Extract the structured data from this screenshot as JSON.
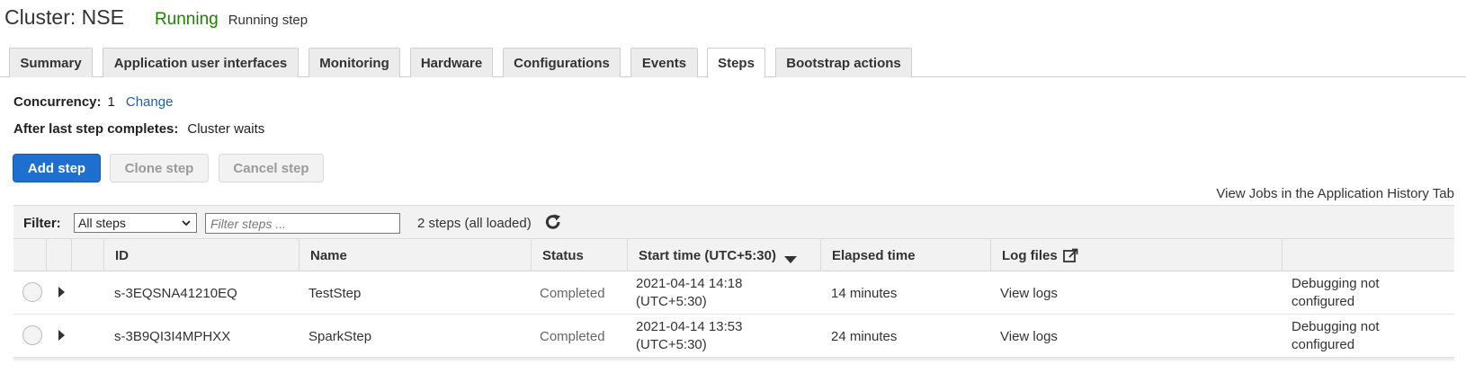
{
  "header": {
    "title": "Cluster: NSE",
    "state": "Running",
    "substate": "Running step",
    "state_color": "#1d8102"
  },
  "tabs": [
    {
      "label": "Summary",
      "active": false
    },
    {
      "label": "Application user interfaces",
      "active": false
    },
    {
      "label": "Monitoring",
      "active": false
    },
    {
      "label": "Hardware",
      "active": false
    },
    {
      "label": "Configurations",
      "active": false
    },
    {
      "label": "Events",
      "active": false
    },
    {
      "label": "Steps",
      "active": true
    },
    {
      "label": "Bootstrap actions",
      "active": false
    }
  ],
  "settings": {
    "concurrency_label": "Concurrency:",
    "concurrency_value": "1",
    "change_label": "Change",
    "after_label": "After last step completes:",
    "after_value": "Cluster waits"
  },
  "actions": {
    "add_label": "Add step",
    "clone_label": "Clone step",
    "cancel_label": "Cancel step"
  },
  "history_link": "View Jobs in the Application History Tab",
  "filter": {
    "label": "Filter:",
    "select_value": "All steps",
    "input_placeholder": "Filter steps ...",
    "count_text": "2 steps (all loaded)"
  },
  "table": {
    "columns": {
      "id": "ID",
      "name": "Name",
      "status": "Status",
      "start_time": "Start time (UTC+5:30)",
      "elapsed": "Elapsed time",
      "log_files": "Log files"
    },
    "rows": [
      {
        "id": "s-3EQSNA41210EQ",
        "name": "TestStep",
        "status": "Completed",
        "start_line1": "2021-04-14 14:18",
        "start_line2": "(UTC+5:30)",
        "elapsed": "14 minutes",
        "log_link": "View logs",
        "debug_line1": "Debugging not",
        "debug_line2": "configured"
      },
      {
        "id": "s-3B9QI3I4MPHXX",
        "name": "SparkStep",
        "status": "Completed",
        "start_line1": "2021-04-14 13:53",
        "start_line2": "(UTC+5:30)",
        "elapsed": "24 minutes",
        "log_link": "View logs",
        "debug_line1": "Debugging not",
        "debug_line2": "configured"
      }
    ]
  },
  "colors": {
    "primary_button": "#1f6fd0",
    "link": "#1f5fa8"
  }
}
